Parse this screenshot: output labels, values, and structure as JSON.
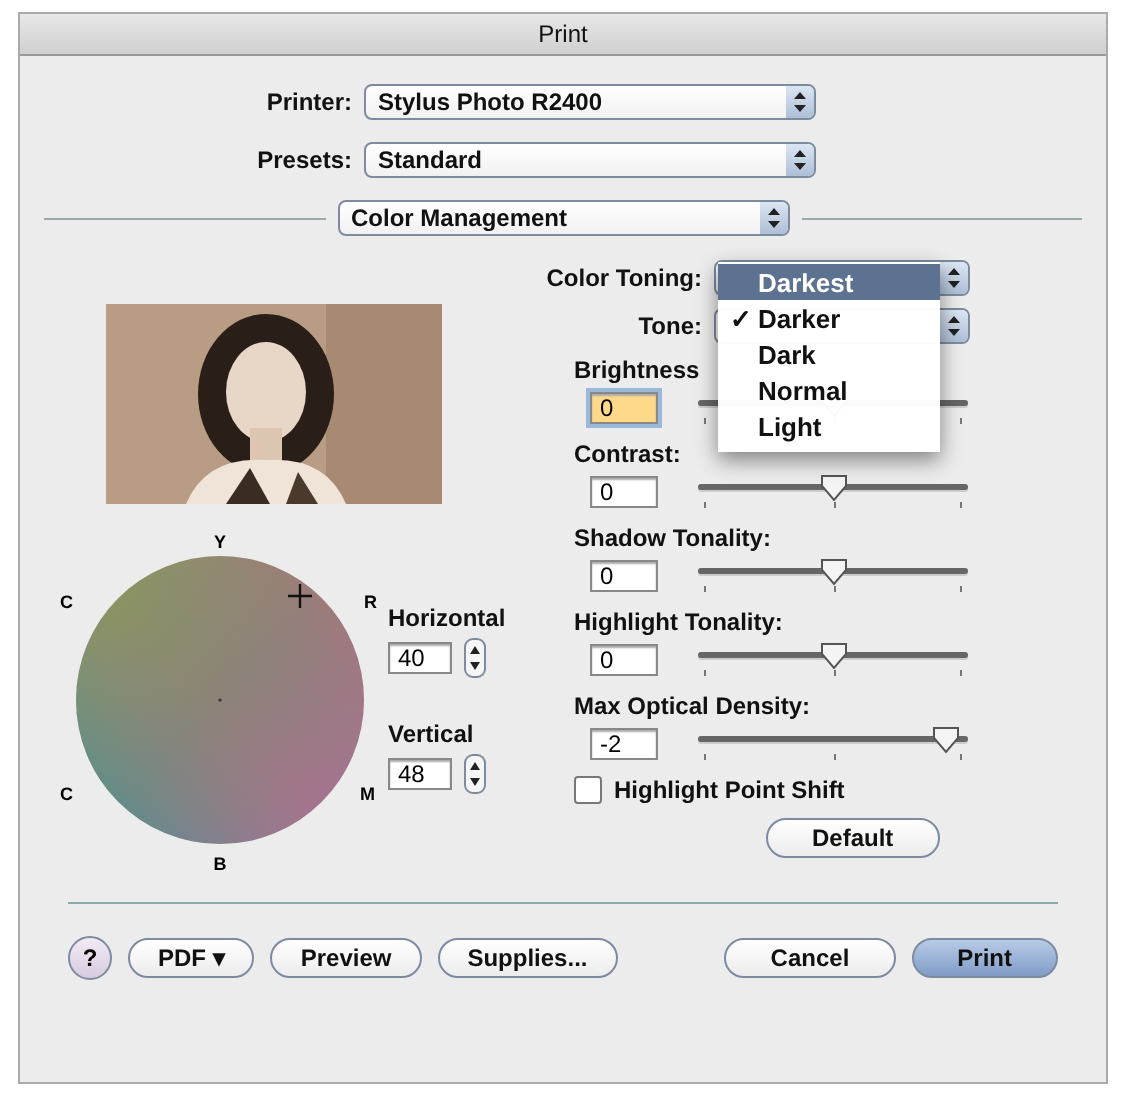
{
  "window": {
    "title": "Print"
  },
  "printer": {
    "label": "Printer:",
    "value": "Stylus Photo R2400"
  },
  "presets": {
    "label": "Presets:",
    "value": "Standard"
  },
  "section": {
    "value": "Color Management"
  },
  "color_wheel": {
    "labels": [
      "Y",
      "C",
      "R",
      "C",
      "M",
      "B"
    ]
  },
  "horizontal": {
    "label": "Horizontal",
    "value": "40"
  },
  "vertical": {
    "label": "Vertical",
    "value": "48"
  },
  "color_toning": {
    "label": "Color Toning:"
  },
  "tone": {
    "label": "Tone:"
  },
  "check_symbol": "✓",
  "tone_menu": [
    {
      "label": "Darkest",
      "selected": true,
      "checked": false
    },
    {
      "label": "Darker",
      "selected": false,
      "checked": true
    },
    {
      "label": "Dark",
      "selected": false,
      "checked": false
    },
    {
      "label": "Normal",
      "selected": false,
      "checked": false
    },
    {
      "label": "Light",
      "selected": false,
      "checked": false
    }
  ],
  "sliders": [
    {
      "label": "Brightness",
      "value": "0",
      "focused": true,
      "level": 0.5
    },
    {
      "label": "Contrast:",
      "value": "0",
      "focused": false,
      "level": 0.5
    },
    {
      "label": "Shadow Tonality:",
      "value": "0",
      "focused": false,
      "level": 0.5
    },
    {
      "label": "Highlight Tonality:",
      "value": "0",
      "focused": false,
      "level": 0.5
    },
    {
      "label": "Max Optical Density:",
      "value": "-2",
      "focused": false,
      "level": 0.92
    }
  ],
  "highlight_point_shift": {
    "label": "Highlight Point Shift",
    "checked": false
  },
  "default_button": "Default",
  "help_button": "?",
  "buttons_left": [
    {
      "label": "PDF ▾"
    },
    {
      "label": "Preview"
    },
    {
      "label": "Supplies..."
    }
  ],
  "buttons_right": [
    {
      "label": "Cancel",
      "default": false
    },
    {
      "label": "Print",
      "default": true
    }
  ]
}
